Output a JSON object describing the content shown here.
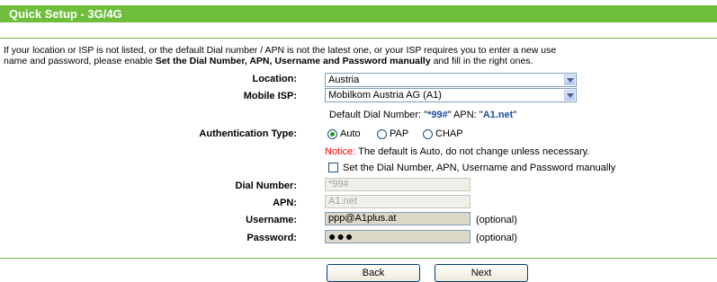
{
  "header": {
    "title": "Quick Setup - 3G/4G"
  },
  "intro": {
    "text_before": "If your location or ISP is not listed, or the default Dial number / APN is not the latest one, or your ISP requires you to enter a new use",
    "line2_before": "name and password, please enable ",
    "line2_bold": "Set the Dial Number, APN, Username and Password manually",
    "line2_after": " and fill in the right ones."
  },
  "form": {
    "location": {
      "label": "Location:",
      "value": "Austria"
    },
    "mobile_isp": {
      "label": "Mobile ISP:",
      "value": "Mobilkom Austria AG (A1)"
    },
    "defaults": {
      "dial_prefix": "Default Dial Number: \"",
      "dial_value": "*99#",
      "dial_suffix": "\"  APN: \"",
      "apn_value": "A1.net",
      "apn_suffix": "\""
    },
    "auth": {
      "label": "Authentication Type:",
      "options": [
        "Auto",
        "PAP",
        "CHAP"
      ],
      "selected": "Auto"
    },
    "notice": {
      "prefix": "Notice:",
      "text": " The default is Auto, do not change unless necessary."
    },
    "manual_checkbox": {
      "label": "Set the Dial Number, APN, Username and Password manually",
      "checked": false
    },
    "dial_number": {
      "label": "Dial Number:",
      "value": "*99#"
    },
    "apn": {
      "label": "APN:",
      "value": "A1.net"
    },
    "username": {
      "label": "Username:",
      "value": "ppp@A1plus.at",
      "hint": "(optional)"
    },
    "password": {
      "label": "Password:",
      "value": "●●●",
      "hint": "(optional)"
    }
  },
  "buttons": {
    "back": "Back",
    "next": "Next"
  },
  "colors": {
    "header": "#6ebe3c",
    "notice": "#ff0000",
    "default_values": "#1c4f9c"
  }
}
